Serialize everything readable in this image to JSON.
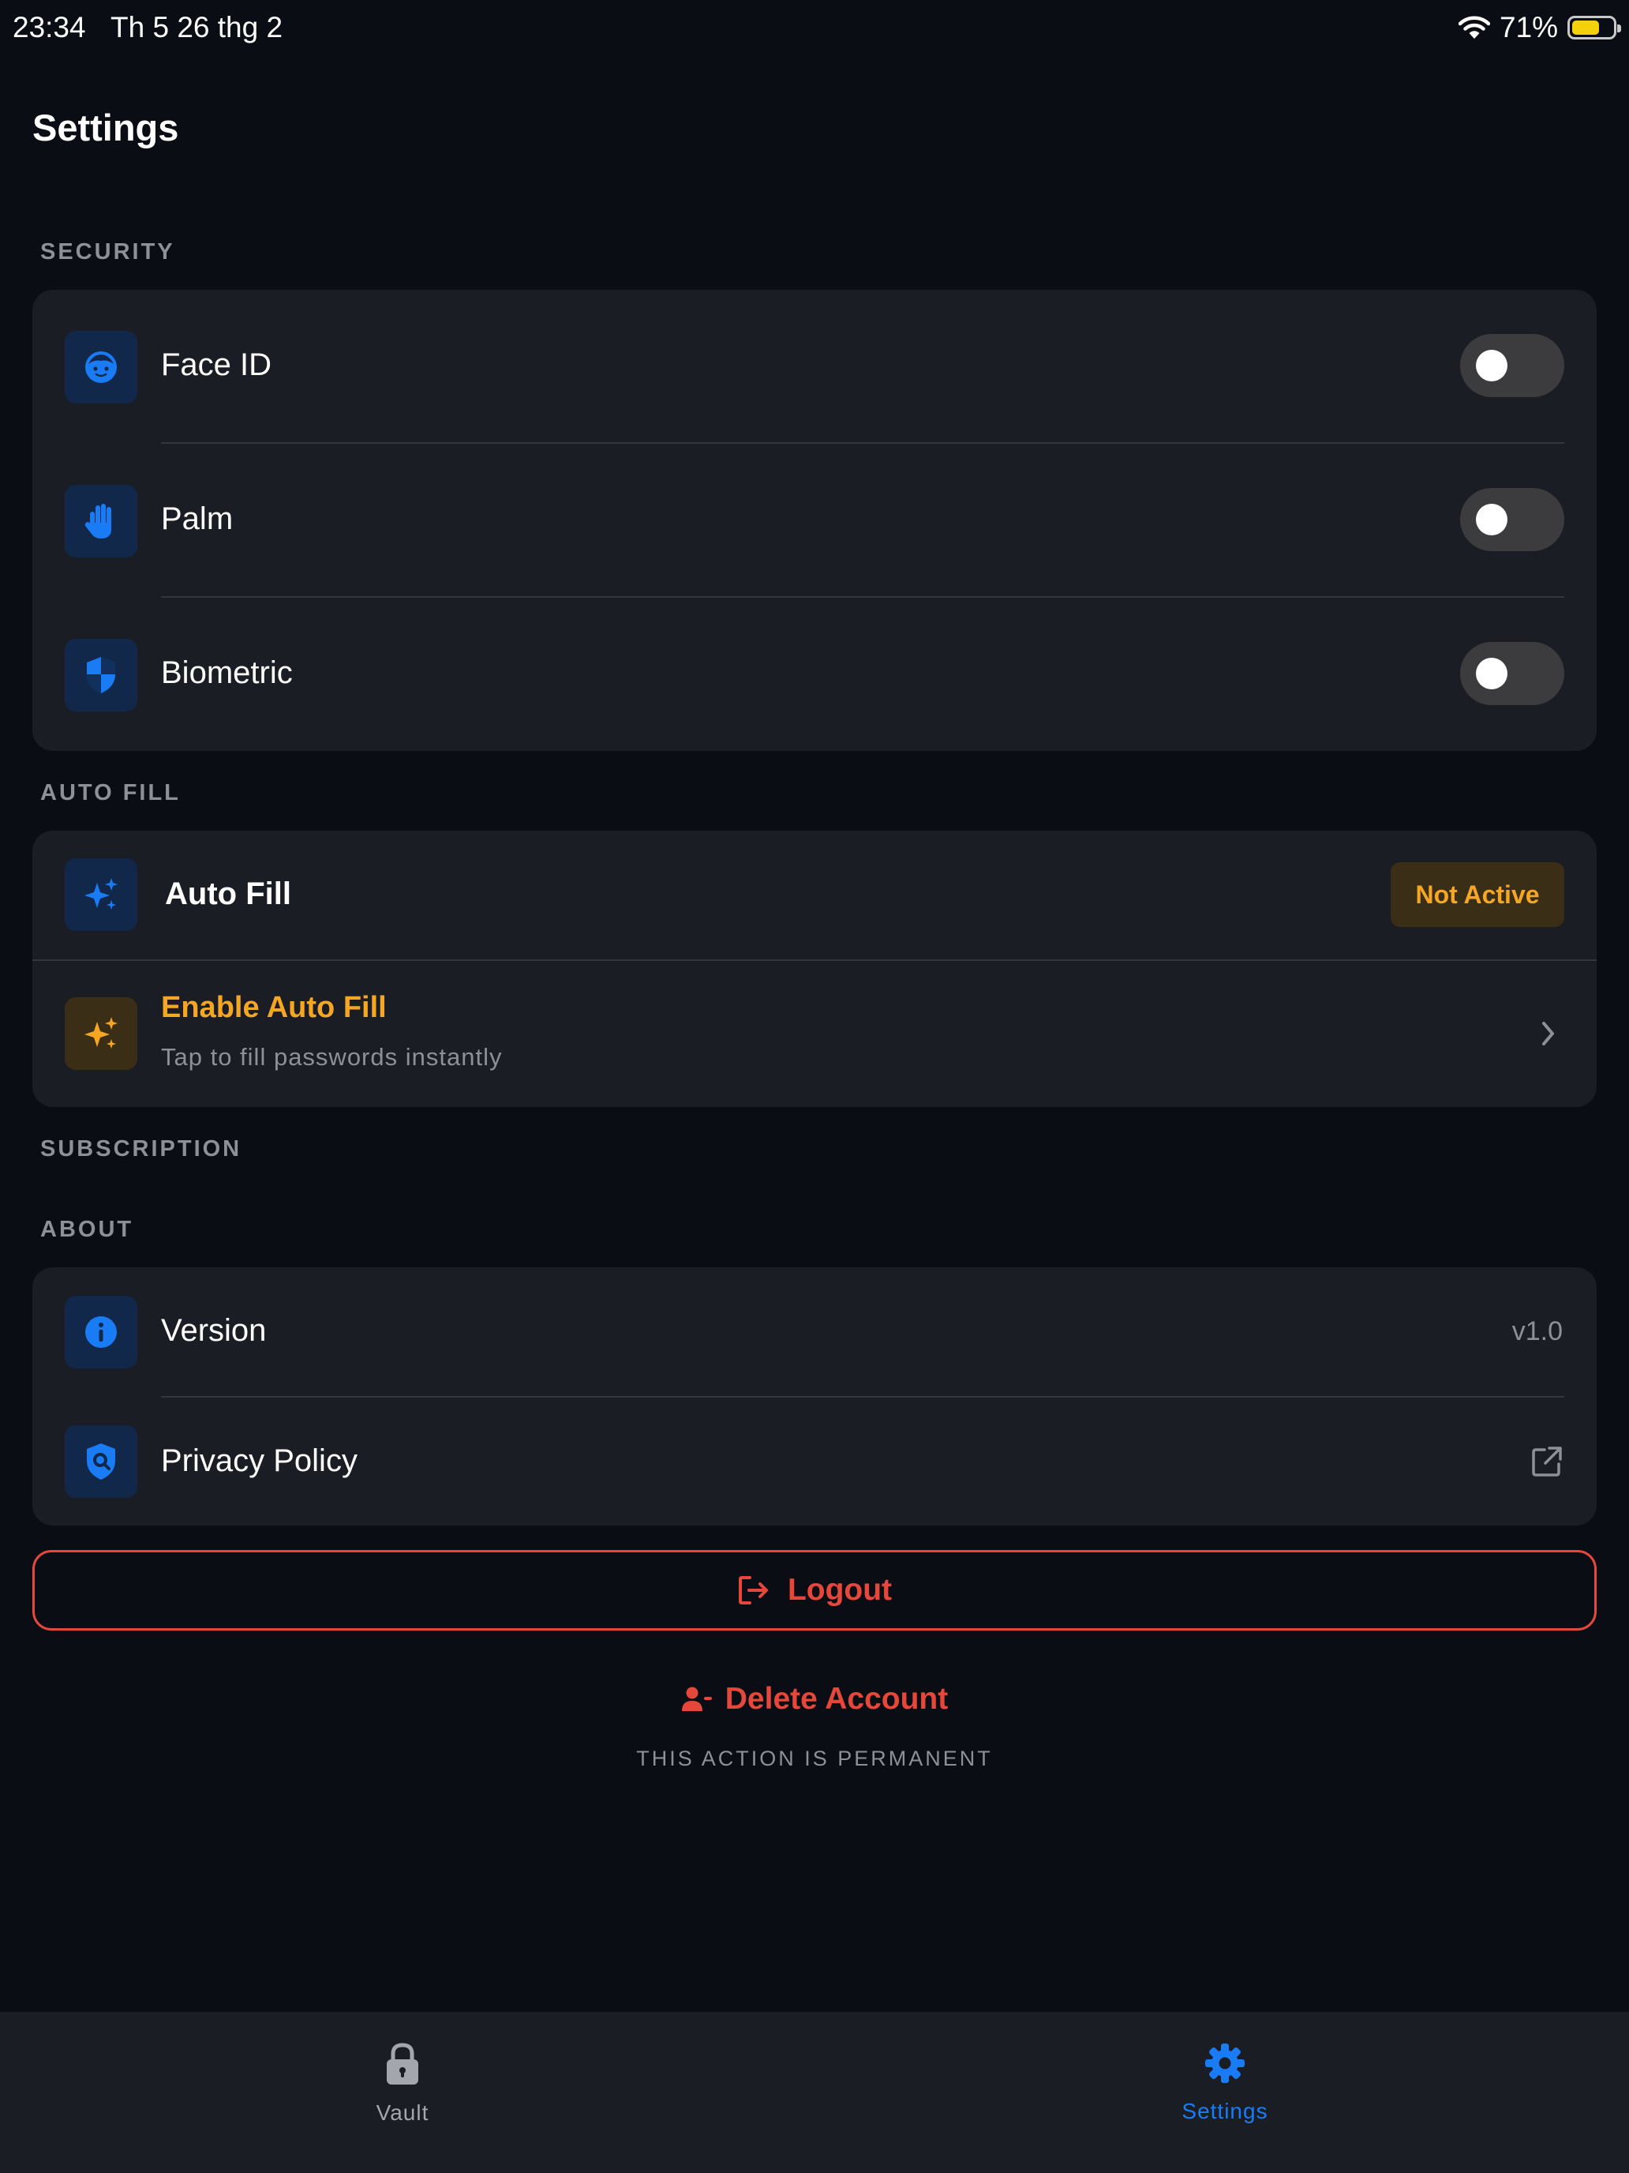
{
  "status_bar": {
    "time": "23:34",
    "date": "Th 5 26 thg 2",
    "battery_percent": "71%",
    "battery_level": 0.71
  },
  "page": {
    "title": "Settings"
  },
  "security": {
    "label": "SECURITY",
    "items": [
      {
        "label": "Face ID",
        "icon": "face-icon",
        "enabled": false
      },
      {
        "label": "Palm",
        "icon": "hand-icon",
        "enabled": false
      },
      {
        "label": "Biometric",
        "icon": "shield-icon",
        "enabled": false
      }
    ]
  },
  "auto_fill": {
    "label": "AUTO FILL",
    "status_row": {
      "label": "Auto Fill",
      "badge": "Not Active",
      "icon": "sparkles-icon"
    },
    "enable_row": {
      "title": "Enable Auto Fill",
      "subtitle": "Tap to fill passwords instantly",
      "icon": "sparkles-icon"
    }
  },
  "subscription": {
    "label": "SUBSCRIPTION"
  },
  "about": {
    "label": "ABOUT",
    "version": {
      "label": "Version",
      "value": "v1.0",
      "icon": "info-icon"
    },
    "privacy": {
      "label": "Privacy Policy",
      "icon": "shield-search-icon"
    }
  },
  "actions": {
    "logout": "Logout",
    "delete_account": "Delete Account",
    "delete_warning": "THIS ACTION IS PERMANENT"
  },
  "tabs": [
    {
      "label": "Vault",
      "icon": "lock-icon",
      "active": false
    },
    {
      "label": "Settings",
      "icon": "gear-icon",
      "active": true
    }
  ],
  "colors": {
    "accent": "#1a7cf5",
    "danger": "#e5483a",
    "warning": "#f5a623",
    "background": "#0b0d14",
    "card": "#1b1d24"
  }
}
